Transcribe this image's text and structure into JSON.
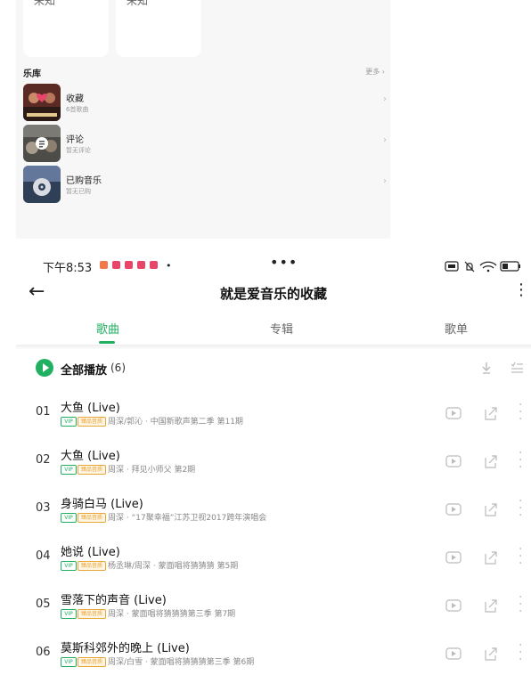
{
  "top_cards": [
    {
      "label": "未知"
    },
    {
      "label": "未知"
    }
  ],
  "library": {
    "title": "乐库",
    "more": "更多 ›",
    "items": [
      {
        "name": "收藏",
        "sub": "6首歌曲"
      },
      {
        "name": "评论",
        "sub": "暂无评论"
      },
      {
        "name": "已购音乐",
        "sub": "暂无已购"
      }
    ]
  },
  "status_bar": {
    "time": "下午8:53",
    "dot": "•",
    "overflow": "•••"
  },
  "header": {
    "title": "就是爱音乐的收藏"
  },
  "tabs": [
    {
      "label": "歌曲",
      "active": true
    },
    {
      "label": "专辑",
      "active": false
    },
    {
      "label": "歌单",
      "active": false
    }
  ],
  "play_all": {
    "label": "全部播放",
    "count": "(6)"
  },
  "badges": {
    "vip": "VIP",
    "hq": "臻品音质"
  },
  "songs": [
    {
      "index": "01",
      "title": "大鱼 (Live)",
      "subtitle": "周深/郭沁 · 中国新歌声第二季 第11期"
    },
    {
      "index": "02",
      "title": "大鱼 (Live)",
      "subtitle": "周深 · 拜见小师父 第2期"
    },
    {
      "index": "03",
      "title": "身骑白马 (Live)",
      "subtitle": "周深 · “17聚幸福”江苏卫视2017跨年演唱会"
    },
    {
      "index": "04",
      "title": "她说 (Live)",
      "subtitle": "杨丞琳/周深 · 蒙面唱将猜猜猜 第5期"
    },
    {
      "index": "05",
      "title": "雪落下的声音 (Live)",
      "subtitle": "周深 · 蒙面唱将猜猜猜第三季 第7期"
    },
    {
      "index": "06",
      "title": "莫斯科郊外的晚上 (Live)",
      "subtitle": "周深/白雪 · 蒙面唱将猜猜猜第三季 第6期"
    }
  ],
  "colors": {
    "accent": "#21b062",
    "notification": "#e8456b",
    "hq_badge": "#e8a63b"
  }
}
